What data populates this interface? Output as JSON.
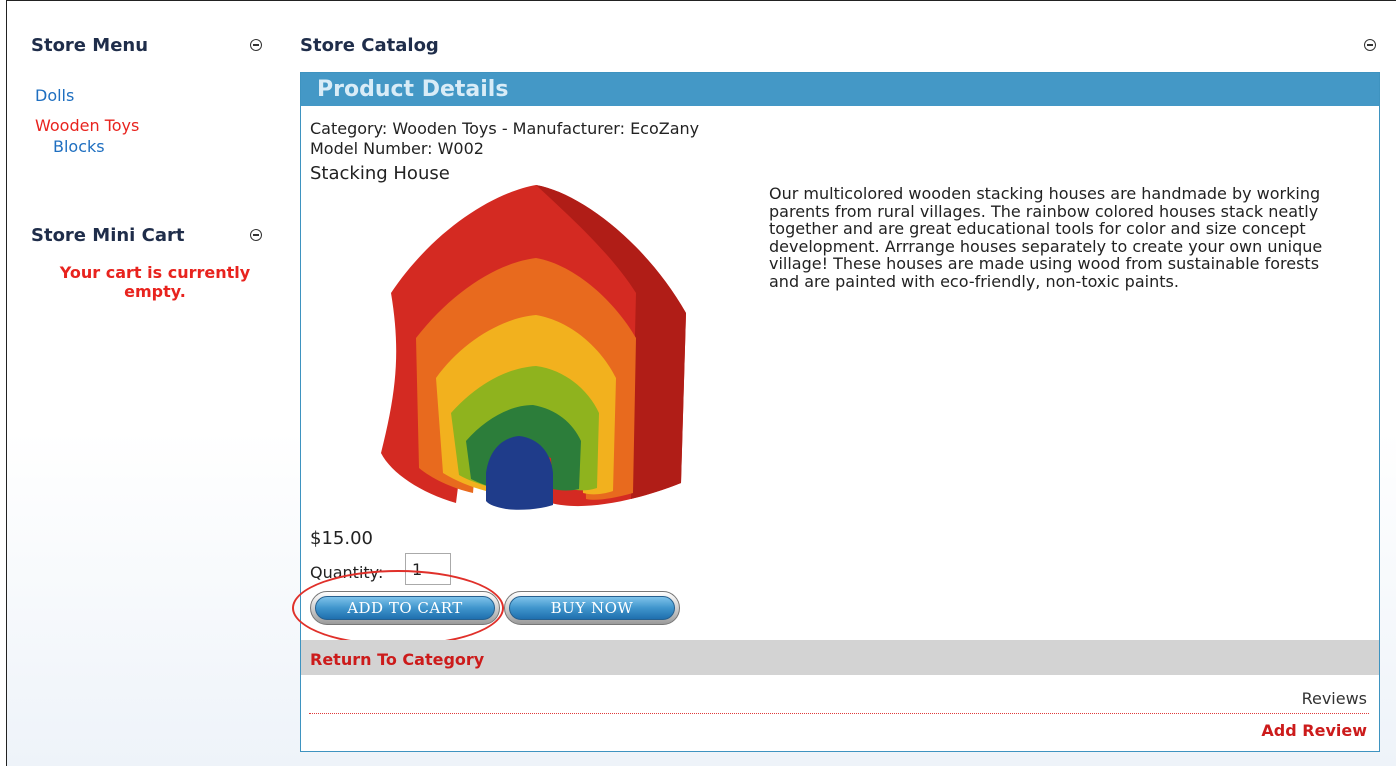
{
  "store_menu": {
    "title": "Store Menu",
    "items": [
      {
        "label": "Dolls",
        "active": false
      },
      {
        "label": "Wooden Toys",
        "active": true
      },
      {
        "label": "Blocks",
        "active": false
      }
    ]
  },
  "mini_cart": {
    "title": "Store Mini Cart",
    "empty_message": "Your cart is currently empty."
  },
  "catalog": {
    "title": "Store Catalog",
    "panel_title": "Product Details",
    "category_line": "Category: Wooden Toys - Manufacturer: EcoZany",
    "model_line": "Model Number: W002",
    "product_name": "Stacking House",
    "description": "Our multicolored wooden stacking houses are handmade by working parents from rural villages. The rainbow colored houses stack neatly together and are great educational tools for color and size concept development. Arrrange houses separately to create your own unique village! These houses are made using wood from sustainable forests and are painted with eco-friendly, non-toxic paints.",
    "price": "$15.00",
    "quantity_label": "Quantity:",
    "quantity_value": "1",
    "add_to_cart_label": "ADD TO CART",
    "buy_now_label": "BUY NOW",
    "return_label": "Return To Category",
    "reviews_label": "Reviews",
    "add_review_label": "Add Review"
  },
  "colors": {
    "panel_header": "#4498c6",
    "link_blue": "#1f6fc0",
    "link_red": "#e8231e",
    "highlight": "#e0302a"
  }
}
